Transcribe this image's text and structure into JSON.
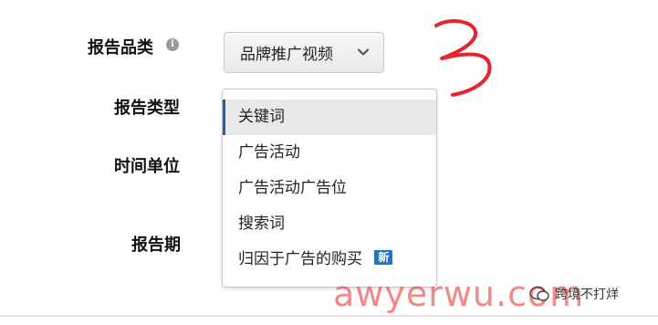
{
  "form": {
    "report_category_label": "报告品类",
    "report_type_label": "报告类型",
    "time_unit_label": "时间单位",
    "report_period_label": "报告期"
  },
  "category_select": {
    "value": "品牌推广视频"
  },
  "report_type_options": [
    {
      "label": "关键词",
      "selected": true
    },
    {
      "label": "广告活动",
      "selected": false
    },
    {
      "label": "广告活动广告位",
      "selected": false
    },
    {
      "label": "搜索词",
      "selected": false
    },
    {
      "label": "归因于广告的购买",
      "selected": false,
      "badge": "新"
    }
  ],
  "annotation": {
    "scribble": "3"
  },
  "watermark": {
    "text": "awyerwu.com",
    "brand": "跨境不打烊"
  },
  "colors": {
    "selected_bar": "#3b5a86",
    "badge": "#1f74c4",
    "scribble": "#e8232a",
    "watermark": "#e62828"
  }
}
